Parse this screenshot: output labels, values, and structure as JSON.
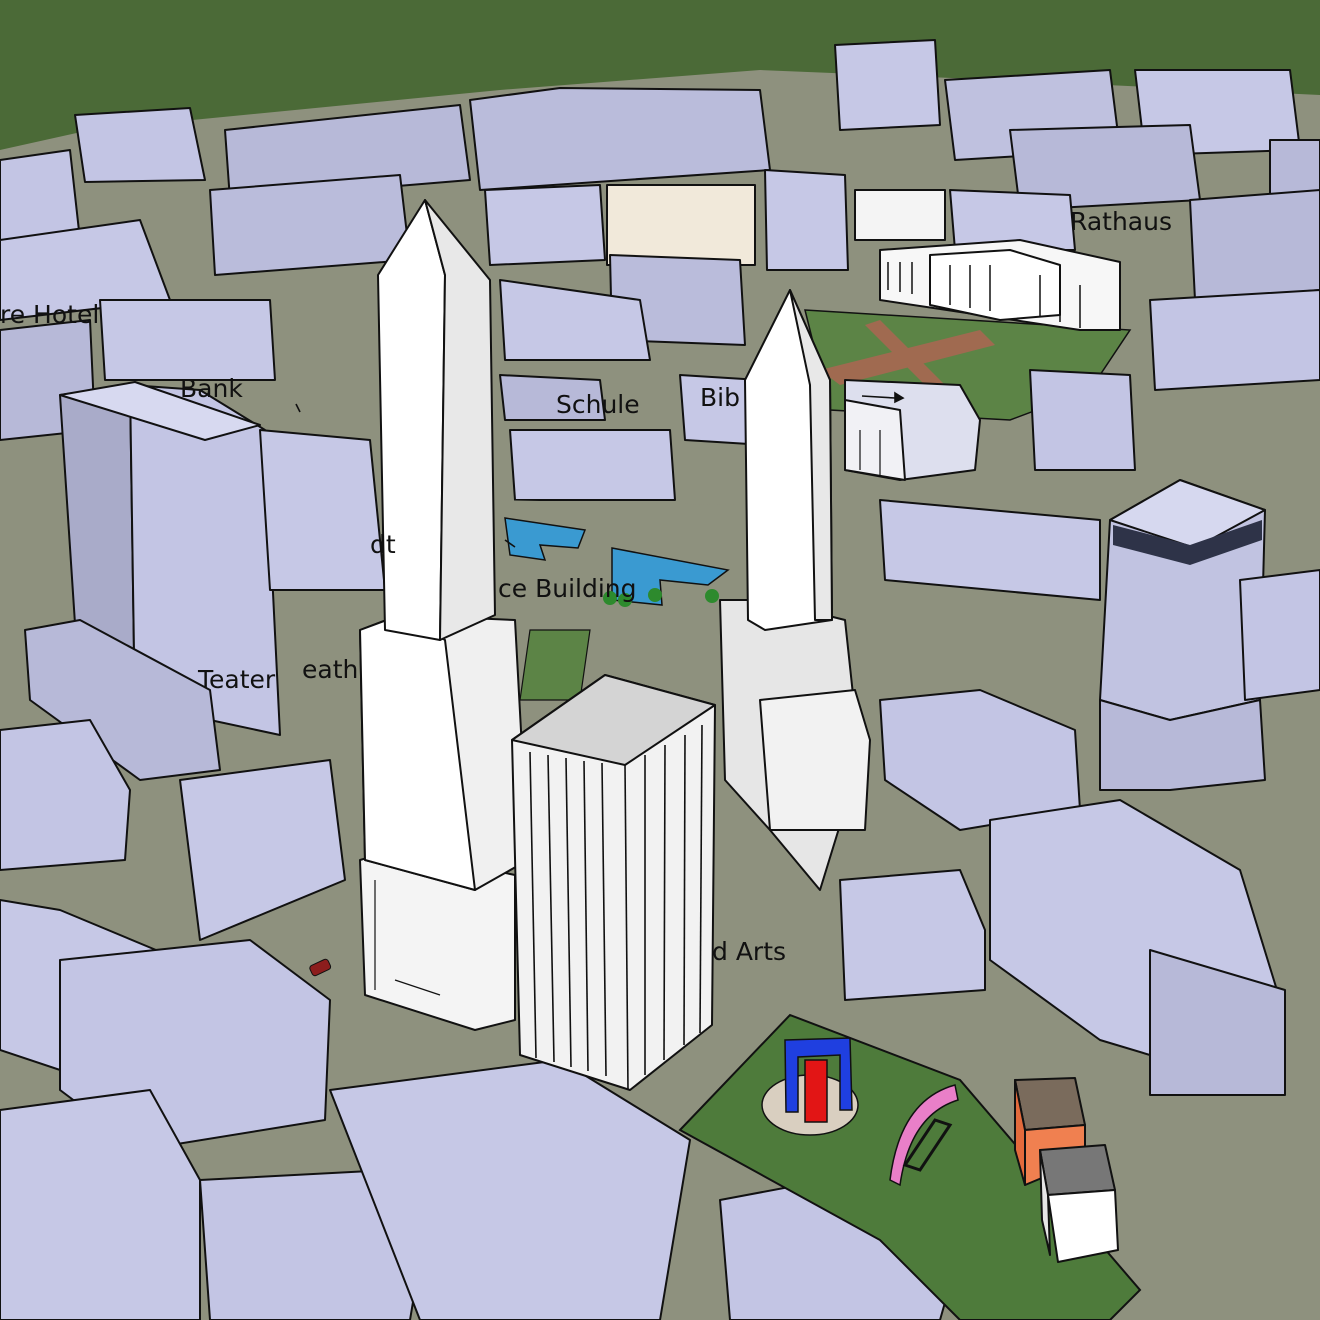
{
  "scene": {
    "background_color": "#4b6a37",
    "street_color": "#8e917e",
    "building_top_color": "#c6c8e6",
    "building_side_color": "#a4a6c4",
    "tower_color": "#f2f2f2"
  },
  "labels": {
    "hotel": "re Hotel",
    "bank": "Bank",
    "schule": "Schule",
    "bib": "Bib",
    "rathaus": "Rathaus",
    "office_building": "ce Building",
    "teater": "Teater",
    "theat": "eath",
    "arts": "d Arts",
    "stadt": "dt"
  }
}
